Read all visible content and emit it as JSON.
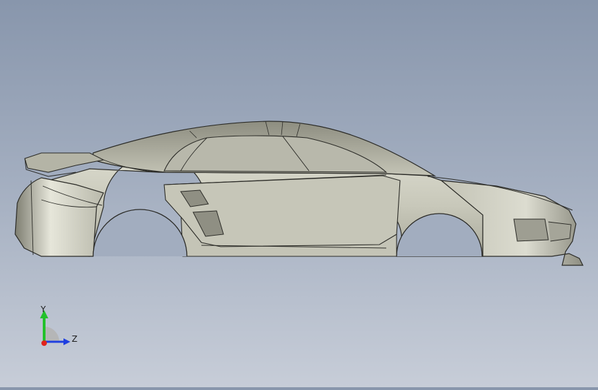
{
  "viewport": {
    "background_top": "#8896ac",
    "background_bottom": "#c7cdd8"
  },
  "model": {
    "body_color": "#c9c9bb",
    "edge_color": "#2a2a26"
  },
  "triad": {
    "y_label": "Y",
    "z_label": "Z",
    "x_color": "#e0231c",
    "y_color": "#22c12a",
    "z_color": "#1f3fe0"
  }
}
